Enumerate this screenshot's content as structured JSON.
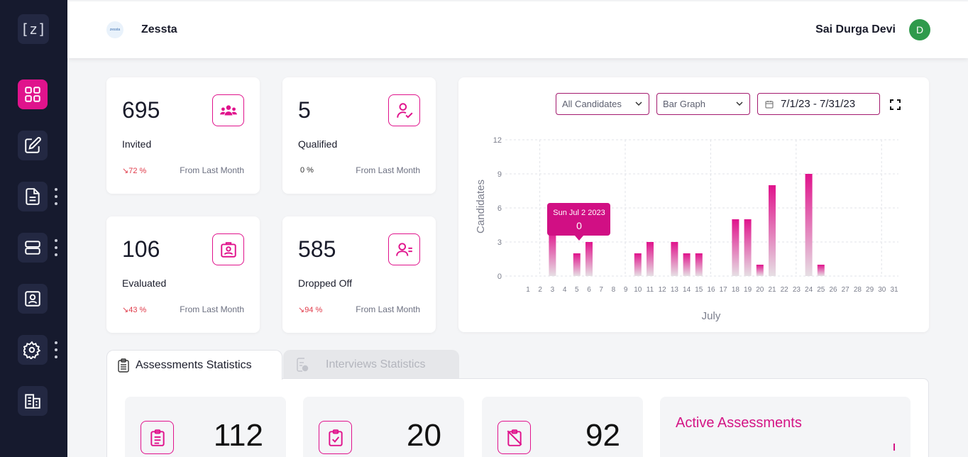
{
  "sidebar": {
    "logo": "[z]",
    "items": [
      {
        "name": "dashboard",
        "icon": "grid-icon",
        "active": true
      },
      {
        "name": "edit",
        "icon": "edit-icon",
        "active": false
      },
      {
        "name": "documents",
        "icon": "document-icon",
        "active": false,
        "menu": true
      },
      {
        "name": "servers",
        "icon": "server-icon",
        "active": false,
        "menu": true
      },
      {
        "name": "candidate-profile",
        "icon": "id-badge-icon",
        "active": false
      },
      {
        "name": "settings",
        "icon": "gear-tools-icon",
        "active": false,
        "menu": true
      },
      {
        "name": "organization",
        "icon": "building-icon",
        "active": false
      }
    ]
  },
  "header": {
    "brand_mark_text": "zessta",
    "brand": "Zessta",
    "user_name": "Sai Durga Devi",
    "avatar_initial": "D"
  },
  "stats": [
    {
      "value": "695",
      "label": "Invited",
      "change": "↘72 %",
      "period": "From Last Month",
      "icon": "users-group-icon"
    },
    {
      "value": "5",
      "label": "Qualified",
      "change": "0 %",
      "period": "From Last Month",
      "icon": "user-check-icon"
    },
    {
      "value": "106",
      "label": "Evaluated",
      "change": "↘43 %",
      "period": "From Last Month",
      "icon": "id-card-icon"
    },
    {
      "value": "585",
      "label": "Dropped Off",
      "change": "↘94 %",
      "period": "From Last Month",
      "icon": "user-minus-icon"
    }
  ],
  "chart_controls": {
    "candidate_filter": "All Candidates",
    "graph_type": "Bar Graph",
    "date_range": "7/1/23 - 7/31/23"
  },
  "tooltip": {
    "date": "Sun Jul 2 2023",
    "value": "0"
  },
  "chart_data": {
    "type": "bar",
    "xlabel": "July",
    "ylabel": "Candidates",
    "ylim": [
      0,
      12
    ],
    "yticks": [
      0,
      3,
      6,
      9,
      12
    ],
    "grid": true,
    "categories": [
      "1",
      "2",
      "3",
      "4",
      "5",
      "6",
      "7",
      "8",
      "9",
      "10",
      "11",
      "12",
      "13",
      "14",
      "15",
      "16",
      "17",
      "18",
      "19",
      "20",
      "21",
      "22",
      "23",
      "24",
      "25",
      "26",
      "27",
      "28",
      "29",
      "30",
      "31"
    ],
    "values": [
      0,
      0,
      4,
      0,
      2,
      3,
      0,
      0,
      0,
      2,
      3,
      0,
      3,
      2,
      2,
      0,
      0,
      5,
      5,
      1,
      8,
      0,
      0,
      9,
      1,
      0,
      0,
      0,
      0,
      0,
      0
    ],
    "bar_color": "#e0138c"
  },
  "tabs": [
    {
      "label": "Assessments Statistics",
      "active": true
    },
    {
      "label": "Interviews Statistics",
      "active": false
    }
  ],
  "assessment_stats": [
    {
      "value": "112",
      "icon": "clipboard-list-icon"
    },
    {
      "value": "20",
      "icon": "clipboard-check-icon"
    },
    {
      "value": "92",
      "icon": "clipboard-off-icon"
    }
  ],
  "active_assessments": {
    "title": "Active Assessments"
  }
}
